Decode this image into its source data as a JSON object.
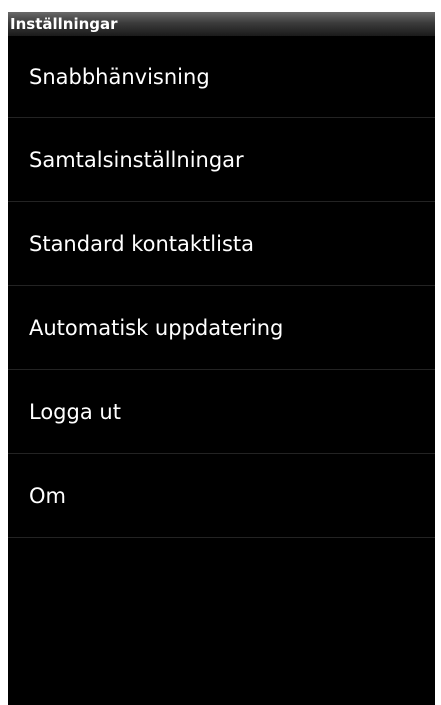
{
  "header": {
    "title": "Inställningar"
  },
  "menu": {
    "items": [
      {
        "label": "Snabbhänvisning"
      },
      {
        "label": "Samtalsinställningar"
      },
      {
        "label": "Standard kontaktlista"
      },
      {
        "label": "Automatisk uppdatering"
      },
      {
        "label": "Logga ut"
      },
      {
        "label": "Om"
      }
    ]
  },
  "colors": {
    "background": "#000000",
    "text": "#ffffff",
    "divider": "#232323",
    "title_bar_top": "#6a6a6a",
    "title_bar_bottom": "#1a1a1a"
  }
}
